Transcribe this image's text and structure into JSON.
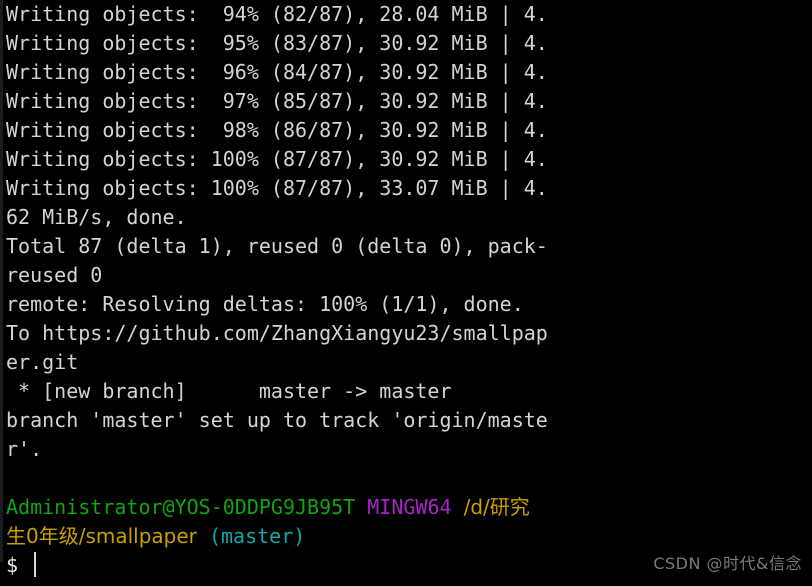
{
  "terminal": {
    "title": "MINGW64 /d/研究生0年级/smallpaper (master)",
    "background_color": "#000000",
    "foreground_color": "#d4d4d4",
    "font_size_px": 20,
    "line_height_px": 29,
    "columns_visible": 50
  },
  "colors": {
    "default": "#d4d4d4",
    "green": "#0ea50e",
    "magenta": "#a625c4",
    "yellow": "#c8a000",
    "cyan": "#11a8a8",
    "white": "#e8e8e8",
    "watermark": "#7a7a7a",
    "gutter": "#1b1b22"
  },
  "output_lines": [
    {
      "id": "writing-94",
      "text": "Writing objects:  94% (82/87), 28.04 MiB | 4."
    },
    {
      "id": "writing-95",
      "text": "Writing objects:  95% (83/87), 30.92 MiB | 4."
    },
    {
      "id": "writing-96",
      "text": "Writing objects:  96% (84/87), 30.92 MiB | 4."
    },
    {
      "id": "writing-97",
      "text": "Writing objects:  97% (85/87), 30.92 MiB | 4."
    },
    {
      "id": "writing-98",
      "text": "Writing objects:  98% (86/87), 30.92 MiB | 4."
    },
    {
      "id": "writing-100-a",
      "text": "Writing objects: 100% (87/87), 30.92 MiB | 4."
    },
    {
      "id": "writing-100-b",
      "text": "Writing objects: 100% (87/87), 33.07 MiB | 4."
    },
    {
      "id": "writing-speed-wrap",
      "text": "62 MiB/s, done."
    },
    {
      "id": "total-objects",
      "text": "Total 87 (delta 1), reused 0 (delta 0), pack-"
    },
    {
      "id": "total-objects-wrap",
      "text": "reused 0"
    },
    {
      "id": "remote-resolving",
      "text": "remote: Resolving deltas: 100% (1/1), done."
    },
    {
      "id": "to-remote-url",
      "text": "To https://github.com/ZhangXiangyu23/smallpap"
    },
    {
      "id": "to-remote-url-wrap",
      "text": "er.git"
    },
    {
      "id": "new-branch",
      "text": " * [new branch]      master -> master"
    },
    {
      "id": "branch-tracking",
      "text": "branch 'master' set up to track 'origin/maste"
    },
    {
      "id": "branch-tracking-wrap",
      "text": "r'."
    },
    {
      "id": "spacer",
      "text": ""
    }
  ],
  "prompt": {
    "user_host": "Administrator@YOS-0DDPG9JB95T",
    "separator_1": " ",
    "shell": "MINGW64",
    "separator_2": " ",
    "path_line1": "/d/研究",
    "path_line2": "生0年级/smallpaper",
    "branch": " (master)",
    "symbol": "$"
  },
  "watermark": {
    "text": "CSDN @时代&信念"
  }
}
